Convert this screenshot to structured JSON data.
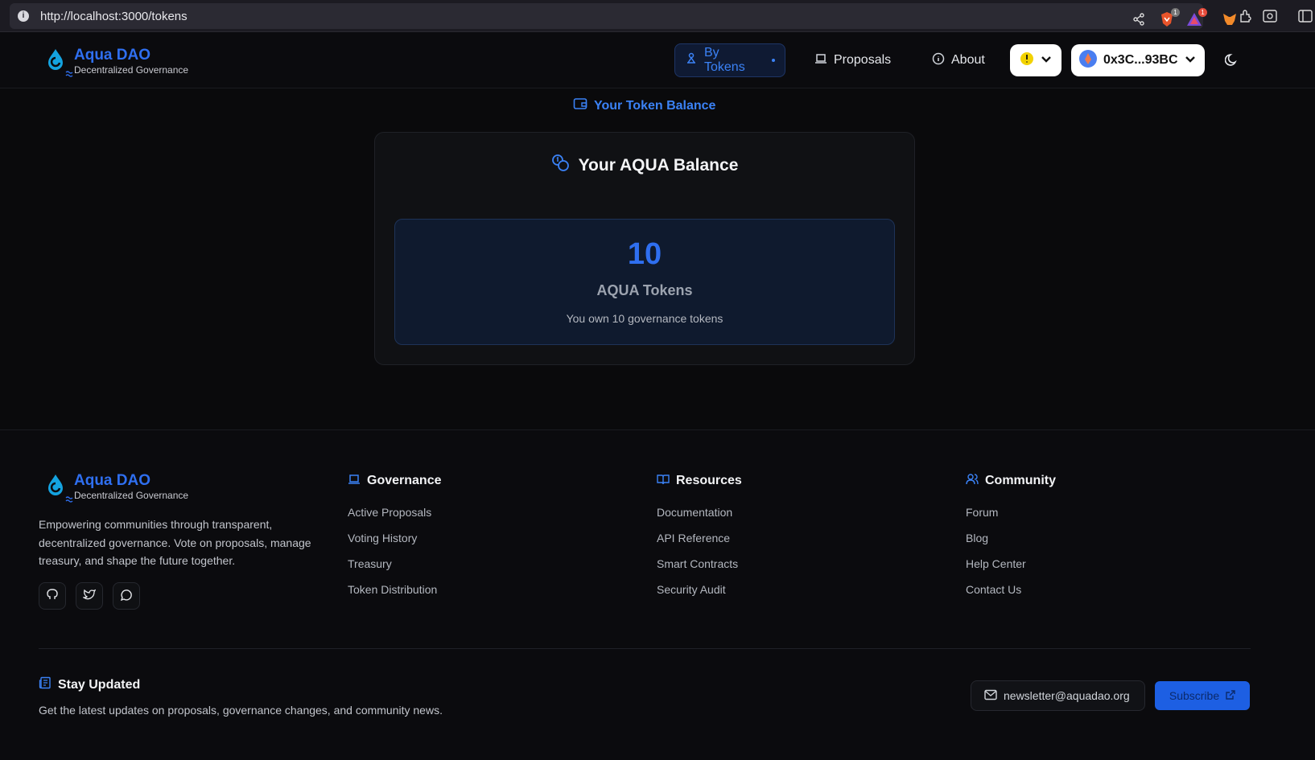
{
  "browser": {
    "url": "http://localhost:3000/tokens",
    "brave_badge": "1",
    "alert_badge": "1"
  },
  "header": {
    "logo_title": "Aqua DAO",
    "logo_subtitle": "Decentralized Governance",
    "nav": {
      "by_tokens": "By Tokens",
      "proposals": "Proposals",
      "about": "About"
    },
    "wallet_address": "0x3C...93BC"
  },
  "main": {
    "section_link": "Your Token Balance",
    "card_title": "Your AQUA Balance",
    "balance_value": "10",
    "balance_unit": "AQUA Tokens",
    "balance_note": "You own 10 governance tokens"
  },
  "footer": {
    "logo_title": "Aqua DAO",
    "logo_subtitle": "Decentralized Governance",
    "about_text": "Empowering communities through transparent, decentralized governance. Vote on proposals, manage treasury, and shape the future together.",
    "columns": [
      {
        "heading": "Governance",
        "links": [
          "Active Proposals",
          "Voting History",
          "Treasury",
          "Token Distribution"
        ]
      },
      {
        "heading": "Resources",
        "links": [
          "Documentation",
          "API Reference",
          "Smart Contracts",
          "Security Audit"
        ]
      },
      {
        "heading": "Community",
        "links": [
          "Forum",
          "Blog",
          "Help Center",
          "Contact Us"
        ]
      }
    ],
    "stay_heading": "Stay Updated",
    "stay_text": "Get the latest updates on proposals, governance changes, and community news.",
    "newsletter_email": "newsletter@aquadao.org",
    "subscribe_label": "Subscribe"
  },
  "colors": {
    "accent": "#2f6ff0",
    "background": "#0a0a0c"
  }
}
